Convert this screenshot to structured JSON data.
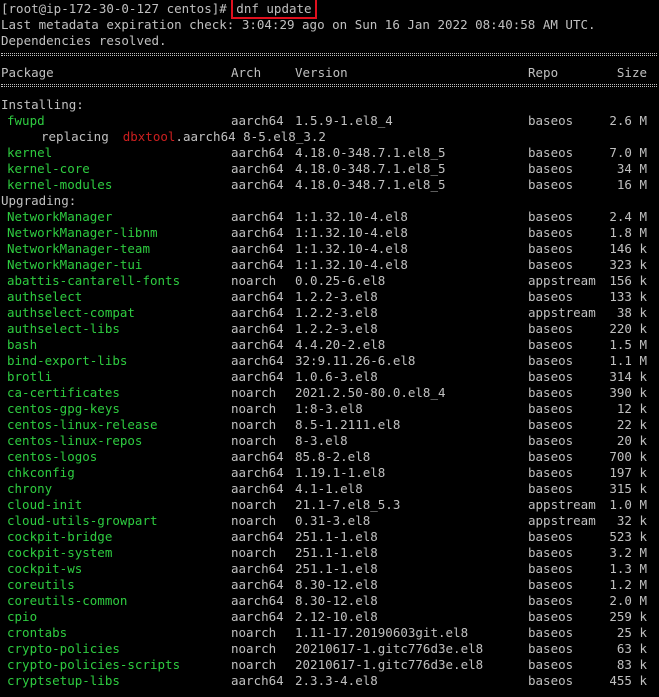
{
  "colors": {
    "background": "#000000",
    "text": "#c0c0c0",
    "package_green": "#2ecc40",
    "highlight_red": "#e0101e",
    "replaced_red": "#cc1f1f"
  },
  "header": {
    "prompt": "[root@ip-172-30-0-127 centos]# ",
    "command": "dnf update",
    "metadata_line": "Last metadata expiration check: 3:04:29 ago on Sun 16 Jan 2022 08:40:58 AM UTC.",
    "resolved_line": "Dependencies resolved."
  },
  "columns": {
    "package": "Package",
    "arch": "Arch",
    "version": "Version",
    "repo": "Repo",
    "size": "Size"
  },
  "installing_label": "Installing:",
  "replacing": {
    "prefix": "replacing",
    "name": "dbxtool",
    "rest": ".aarch64 8-5.el8_3.2"
  },
  "upgrading_label": "Upgrading:",
  "installing": [
    {
      "name": "fwupd",
      "arch": "aarch64",
      "version": "1.5.9-1.el8_4",
      "repo": "baseos",
      "size": "2.6 M"
    },
    {
      "name": "kernel",
      "arch": "aarch64",
      "version": "4.18.0-348.7.1.el8_5",
      "repo": "baseos",
      "size": "7.0 M"
    },
    {
      "name": "kernel-core",
      "arch": "aarch64",
      "version": "4.18.0-348.7.1.el8_5",
      "repo": "baseos",
      "size": "34 M"
    },
    {
      "name": "kernel-modules",
      "arch": "aarch64",
      "version": "4.18.0-348.7.1.el8_5",
      "repo": "baseos",
      "size": "16 M"
    }
  ],
  "upgrading": [
    {
      "name": "NetworkManager",
      "arch": "aarch64",
      "version": "1:1.32.10-4.el8",
      "repo": "baseos",
      "size": "2.4 M"
    },
    {
      "name": "NetworkManager-libnm",
      "arch": "aarch64",
      "version": "1:1.32.10-4.el8",
      "repo": "baseos",
      "size": "1.8 M"
    },
    {
      "name": "NetworkManager-team",
      "arch": "aarch64",
      "version": "1:1.32.10-4.el8",
      "repo": "baseos",
      "size": "146 k"
    },
    {
      "name": "NetworkManager-tui",
      "arch": "aarch64",
      "version": "1:1.32.10-4.el8",
      "repo": "baseos",
      "size": "323 k"
    },
    {
      "name": "abattis-cantarell-fonts",
      "arch": "noarch",
      "version": "0.0.25-6.el8",
      "repo": "appstream",
      "size": "156 k"
    },
    {
      "name": "authselect",
      "arch": "aarch64",
      "version": "1.2.2-3.el8",
      "repo": "baseos",
      "size": "133 k"
    },
    {
      "name": "authselect-compat",
      "arch": "aarch64",
      "version": "1.2.2-3.el8",
      "repo": "appstream",
      "size": "38 k"
    },
    {
      "name": "authselect-libs",
      "arch": "aarch64",
      "version": "1.2.2-3.el8",
      "repo": "baseos",
      "size": "220 k"
    },
    {
      "name": "bash",
      "arch": "aarch64",
      "version": "4.4.20-2.el8",
      "repo": "baseos",
      "size": "1.5 M"
    },
    {
      "name": "bind-export-libs",
      "arch": "aarch64",
      "version": "32:9.11.26-6.el8",
      "repo": "baseos",
      "size": "1.1 M"
    },
    {
      "name": "brotli",
      "arch": "aarch64",
      "version": "1.0.6-3.el8",
      "repo": "baseos",
      "size": "314 k"
    },
    {
      "name": "ca-certificates",
      "arch": "noarch",
      "version": "2021.2.50-80.0.el8_4",
      "repo": "baseos",
      "size": "390 k"
    },
    {
      "name": "centos-gpg-keys",
      "arch": "noarch",
      "version": "1:8-3.el8",
      "repo": "baseos",
      "size": "12 k"
    },
    {
      "name": "centos-linux-release",
      "arch": "noarch",
      "version": "8.5-1.2111.el8",
      "repo": "baseos",
      "size": "22 k"
    },
    {
      "name": "centos-linux-repos",
      "arch": "noarch",
      "version": "8-3.el8",
      "repo": "baseos",
      "size": "20 k"
    },
    {
      "name": "centos-logos",
      "arch": "aarch64",
      "version": "85.8-2.el8",
      "repo": "baseos",
      "size": "700 k"
    },
    {
      "name": "chkconfig",
      "arch": "aarch64",
      "version": "1.19.1-1.el8",
      "repo": "baseos",
      "size": "197 k"
    },
    {
      "name": "chrony",
      "arch": "aarch64",
      "version": "4.1-1.el8",
      "repo": "baseos",
      "size": "315 k"
    },
    {
      "name": "cloud-init",
      "arch": "noarch",
      "version": "21.1-7.el8_5.3",
      "repo": "appstream",
      "size": "1.0 M"
    },
    {
      "name": "cloud-utils-growpart",
      "arch": "noarch",
      "version": "0.31-3.el8",
      "repo": "appstream",
      "size": "32 k"
    },
    {
      "name": "cockpit-bridge",
      "arch": "aarch64",
      "version": "251.1-1.el8",
      "repo": "baseos",
      "size": "523 k"
    },
    {
      "name": "cockpit-system",
      "arch": "noarch",
      "version": "251.1-1.el8",
      "repo": "baseos",
      "size": "3.2 M"
    },
    {
      "name": "cockpit-ws",
      "arch": "aarch64",
      "version": "251.1-1.el8",
      "repo": "baseos",
      "size": "1.3 M"
    },
    {
      "name": "coreutils",
      "arch": "aarch64",
      "version": "8.30-12.el8",
      "repo": "baseos",
      "size": "1.2 M"
    },
    {
      "name": "coreutils-common",
      "arch": "aarch64",
      "version": "8.30-12.el8",
      "repo": "baseos",
      "size": "2.0 M"
    },
    {
      "name": "cpio",
      "arch": "aarch64",
      "version": "2.12-10.el8",
      "repo": "baseos",
      "size": "259 k"
    },
    {
      "name": "crontabs",
      "arch": "noarch",
      "version": "1.11-17.20190603git.el8",
      "repo": "baseos",
      "size": "25 k"
    },
    {
      "name": "crypto-policies",
      "arch": "noarch",
      "version": "20210617-1.gitc776d3e.el8",
      "repo": "baseos",
      "size": "63 k"
    },
    {
      "name": "crypto-policies-scripts",
      "arch": "noarch",
      "version": "20210617-1.gitc776d3e.el8",
      "repo": "baseos",
      "size": "83 k"
    },
    {
      "name": "cryptsetup-libs",
      "arch": "aarch64",
      "version": "2.3.3-4.el8",
      "repo": "baseos",
      "size": "455 k"
    }
  ]
}
